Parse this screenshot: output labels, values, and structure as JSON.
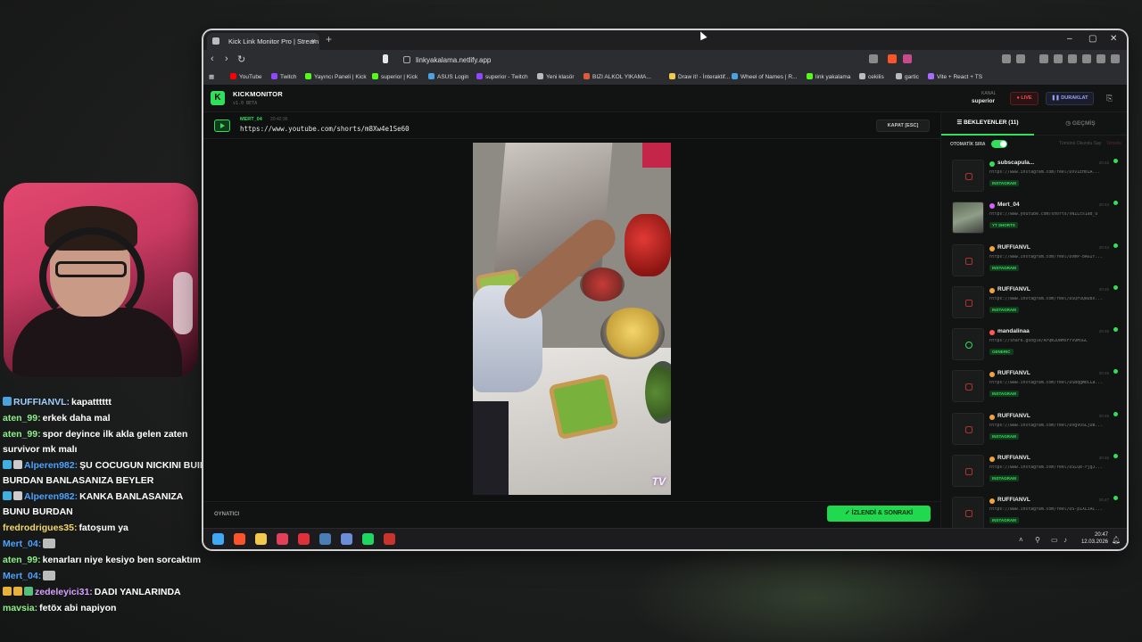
{
  "chat": [
    {
      "user": "RUFFIANVL:",
      "text": "kapatttttt",
      "color": "#9fd0ff",
      "badges": [
        "#4aa3df"
      ]
    },
    {
      "user": "aten_99:",
      "text": "erkek daha mal",
      "color": "#8ef08a",
      "badges": []
    },
    {
      "user": "aten_99:",
      "text": "spor deyince ilk akla gelen zaten survivor mk malı",
      "color": "#8ef08a",
      "badges": []
    },
    {
      "user": "Alperen982:",
      "text": "ŞU COCUGUN NICKINI BUII BURDAN BANLASANIZA BEYLER",
      "color": "#4aa3ff",
      "badges": [
        "#3fb0e0",
        "#cccccc"
      ]
    },
    {
      "user": "Alperen982:",
      "text": "KANKA BANLASANIZA BUNU BURDAN",
      "color": "#4aa3ff",
      "badges": [
        "#3fb0e0",
        "#cccccc"
      ]
    },
    {
      "user": "fredrodrigues35:",
      "text": "fatoşum ya",
      "color": "#f2d86b",
      "badges": []
    },
    {
      "user": "Mert_04:",
      "text": "",
      "color": "#4aa3ff",
      "badges": [],
      "emote": true
    },
    {
      "user": "aten_99:",
      "text": "kenarları niye kesiyo ben sorcaktım",
      "color": "#8ef08a",
      "badges": []
    },
    {
      "user": "Mert_04:",
      "text": "",
      "color": "#4aa3ff",
      "badges": [],
      "emote": true
    },
    {
      "user": "zedeleyici31:",
      "text": "DADI YANLARINDA",
      "color": "#d8a0ff",
      "badges": [
        "#e8b23a",
        "#e8b23a",
        "#55c07a"
      ]
    },
    {
      "user": "mavsia:",
      "text": "fetöx abi napiyon",
      "color": "#8ef08a",
      "badges": []
    }
  ],
  "browser": {
    "tab_title": "Kick Link Monitor Pro | Stream",
    "url": "linkyakalama.netlify.app",
    "bookmarks": [
      {
        "label": "YouTube",
        "color": "#ff0000"
      },
      {
        "label": "Twitch",
        "color": "#9146ff"
      },
      {
        "label": "Yayıncı Paneli | Kick",
        "color": "#53fc18"
      },
      {
        "label": "superior | Kick",
        "color": "#53fc18"
      },
      {
        "label": "ASUS Login",
        "color": "#4aa3df"
      },
      {
        "label": "superior - Twitch",
        "color": "#9146ff"
      },
      {
        "label": "Yeni klasör",
        "color": "#bbbbbb"
      },
      {
        "label": "BIZI ALKOL YIKAMA...",
        "color": "#e05a3a"
      },
      {
        "label": "Draw it! - İnteraktif...",
        "color": "#f2c94c"
      },
      {
        "label": "Wheel of Names | R...",
        "color": "#4aa3df"
      },
      {
        "label": "link yakalama",
        "color": "#53fc18"
      },
      {
        "label": "cekilis",
        "color": "#bbbbbb"
      },
      {
        "label": "gartic",
        "color": "#bbbbbb"
      },
      {
        "label": "Vite + React + TS",
        "color": "#a86bff"
      }
    ]
  },
  "app": {
    "brand_kick": "KICK",
    "brand_monitor": "MONITOR",
    "version": "v1.0 BETA",
    "kanal_label": "KANAL",
    "kanal_value": "superior",
    "live_label": "LIVE",
    "pause_label": "DURAKLAT",
    "now": {
      "user": "MERT_04",
      "time": "20:42:36",
      "url": "https://www.youtube.com/shorts/m8Xw4e1Se60",
      "close_label": "KAPAT [ESC]"
    },
    "player_label": "OYNATICI",
    "next_label": "İZLENDİ & SONRAKİ",
    "watermark": "TV",
    "panel": {
      "tab_waiting": "BEKLEYENLER (11)",
      "tab_history": "GEÇMİŞ",
      "auto_label": "OTOMATİK SIRA",
      "mark_all": "Tümünü Okundu Say",
      "clear": "Temizle"
    },
    "queue": [
      {
        "name": "subscapula...",
        "time": "20:42",
        "url": "https://www.instagram.com/reel/DVvIEH0IA...",
        "tag": "INSTAGRAM",
        "dot": "#2ee05a",
        "thumb": "ig"
      },
      {
        "name": "Mert_04",
        "time": "20:44",
        "url": "https://www.youtube.com/shorts/vNZLcs1ad_U",
        "tag": "YT SHORTS",
        "dot": "#d860ff",
        "thumb": "img"
      },
      {
        "name": "RUFFIANVL",
        "time": "20:44",
        "url": "https://www.instagram.com/reel/DVmP-bAGIf...",
        "tag": "INSTAGRAM",
        "dot": "#f2a33a",
        "thumb": "ig"
      },
      {
        "name": "RUFFIANVL",
        "time": "20:45",
        "url": "https://www.instagram.com/reel/DSQFuQeD8V...",
        "tag": "INSTAGRAM",
        "dot": "#f2a33a",
        "thumb": "ig"
      },
      {
        "name": "mandalinaa",
        "time": "20:45",
        "url": "https://share.google/ArQm2DNMsFrv9MSGC",
        "tag": "GENERIC",
        "dot": "#ff5a5a",
        "thumb": "link"
      },
      {
        "name": "RUFFIANVL",
        "time": "20:46",
        "url": "https://www.instagram.com/reel/DSBqgWbCLa...",
        "tag": "INSTAGRAM",
        "dot": "#f2a33a",
        "thumb": "ig"
      },
      {
        "name": "RUFFIANVL",
        "time": "20:46",
        "url": "https://www.instagram.com/reel/DVgVUSLjDB...",
        "tag": "INSTAGRAM",
        "dot": "#f2a33a",
        "thumb": "ig"
      },
      {
        "name": "RUFFIANVL",
        "time": "20:46",
        "url": "https://www.instagram.com/reel/DSLQe-rjgJ...",
        "tag": "INSTAGRAM",
        "dot": "#f2a33a",
        "thumb": "ig"
      },
      {
        "name": "RUFFIANVL",
        "time": "20:47",
        "url": "https://www.instagram.com/reel/DS-p1XLiAC...",
        "tag": "INSTAGRAM",
        "dot": "#f2a33a",
        "thumb": "ig"
      }
    ]
  },
  "taskbar": {
    "time": "20:47",
    "date": "12.03.2026",
    "apps": [
      {
        "name": "windows-start-icon",
        "color": "#3fa9f5"
      },
      {
        "name": "brave-icon",
        "color": "#fb542b"
      },
      {
        "name": "file-explorer-icon",
        "color": "#f2c94c"
      },
      {
        "name": "map-pin-icon",
        "color": "#e0405a"
      },
      {
        "name": "red-app-icon",
        "color": "#e0303a"
      },
      {
        "name": "steam-icon",
        "color": "#4a7fb5"
      },
      {
        "name": "app-circle-icon",
        "color": "#6a8fd8"
      },
      {
        "name": "spotify-icon",
        "color": "#1ed760"
      },
      {
        "name": "stream-app-icon",
        "color": "#c8342c"
      }
    ]
  }
}
